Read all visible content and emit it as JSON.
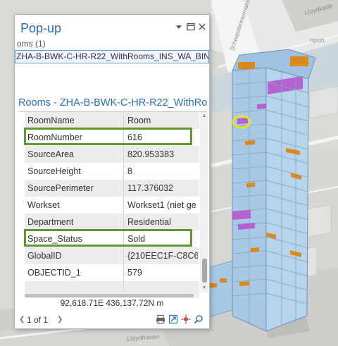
{
  "popup": {
    "title": "Pop-up",
    "feature_count": "oms (1)",
    "selected_feature": "ZHA-B-BWK-C-HR-R22_WithRooms_INS_WA_BIND",
    "layer_title": "Rooms - ZHA-B-BWK-C-HR-R22_WithRo...",
    "attributes": [
      {
        "key": "RoomName",
        "value": "Room"
      },
      {
        "key": "RoomNumber",
        "value": "616"
      },
      {
        "key": "SourceArea",
        "value": "820.953383"
      },
      {
        "key": "SourceHeight",
        "value": "8"
      },
      {
        "key": "SourcePerimeter",
        "value": "117.376032"
      },
      {
        "key": "Workset",
        "value": "Workset1 (niet ge"
      },
      {
        "key": "Department",
        "value": "Residential"
      },
      {
        "key": "Space_Status",
        "value": "Sold"
      },
      {
        "key": "GlobalID",
        "value": "{210EEC1F-C8C6-4"
      },
      {
        "key": "OBJECTID_1",
        "value": "579"
      }
    ],
    "coordinates": "92,618.71E 436,137.72N m",
    "paging": "1 of 1",
    "icons": {
      "pin": "pin-icon",
      "maximize": "maximize-icon",
      "close": "close-icon",
      "print": "print-icon",
      "export": "export-icon",
      "zoom_to": "zoom-to-icon",
      "search": "search-icon"
    }
  },
  "map": {
    "labels": [
      "nport",
      "Scheepstimmermanstraat",
      "Lloydkade",
      "Lloydhaven"
    ]
  },
  "colors": {
    "accent": "#2a6eb4",
    "highlight_border": "#5f9a2e",
    "building": "#a9c8e3",
    "room_orange": "#d98a1e",
    "room_purple": "#b462d0",
    "selection_ring": "#f2e600"
  }
}
